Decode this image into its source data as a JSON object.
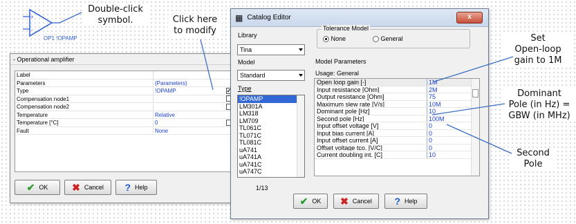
{
  "annotations": {
    "double_click": "Double-click\nsymbol.",
    "click_here": "Click here\nto modify",
    "set_open_loop": "Set\nOpen-loop\ngain to 1M",
    "dominant_pole": "Dominant\nPole (in Hz) =\nGBW (in MHz)",
    "second_pole": "Second\nPole"
  },
  "symbol": {
    "label": "OP1 !OPAMP",
    "plus": "+",
    "minus": "-"
  },
  "opamp_dialog": {
    "title": "- Operational amplifier",
    "rows": [
      {
        "name": "Label",
        "value": "",
        "check": false,
        "has_check": false
      },
      {
        "name": "Parameters",
        "value": "(Parameters)",
        "has_check": false
      },
      {
        "name": "Type",
        "value": "!OPAMP",
        "dots": "...",
        "has_check": true,
        "check": true
      },
      {
        "name": "Compensation node1",
        "value": "",
        "has_check": true,
        "check": false
      },
      {
        "name": "Compensation node2",
        "value": "",
        "has_check": true,
        "check": false
      },
      {
        "name": "Temperature",
        "value": "Relative",
        "has_check": false
      },
      {
        "name": "Temperature [°C]",
        "value": "0",
        "has_check": true,
        "check": false
      },
      {
        "name": "Fault",
        "value": "None",
        "has_check": false
      }
    ],
    "ok": "OK",
    "cancel": "Cancel",
    "help": "Help"
  },
  "catalog": {
    "title": "Catalog Editor",
    "close": "x",
    "library_label": "Library",
    "library_value": "Tina",
    "model_label": "Model",
    "model_value": "Standard",
    "type_label": "Type",
    "types": [
      "!OPAMP",
      "LM301A",
      "LM318",
      "LM709",
      "TL061C",
      "TL071C",
      "TL081C",
      "uA741",
      "uA741A",
      "uA741C",
      "uA747C"
    ],
    "tolerance_title": "Tolerance Model",
    "tol_none": "None",
    "tol_general": "General",
    "params_title": "Model Parameters",
    "usage": "Usage: General",
    "params": [
      {
        "name": "Open loop gain       [-]",
        "value": "1M"
      },
      {
        "name": "Input resistance  [Ohm]",
        "value": "2M"
      },
      {
        "name": "Output resistance  [Ohm]",
        "value": "75"
      },
      {
        "name": "Maximum slew rate  [V/s]",
        "value": "10M"
      },
      {
        "name": "Dominant pole        [Hz]",
        "value": "10"
      },
      {
        "name": "Second pole          [Hz]",
        "value": "100M"
      },
      {
        "name": "Input offset voltage  [V]",
        "value": "0"
      },
      {
        "name": "Input bias current    [A]",
        "value": "0"
      },
      {
        "name": "Input offset current  [A]",
        "value": "0"
      },
      {
        "name": "Offset voltage tco. [V/C]",
        "value": "0"
      },
      {
        "name": "Current doubling int. [C]",
        "value": "10"
      }
    ],
    "page": "1/13",
    "ok": "OK",
    "cancel": "Cancel",
    "help": "Help"
  }
}
